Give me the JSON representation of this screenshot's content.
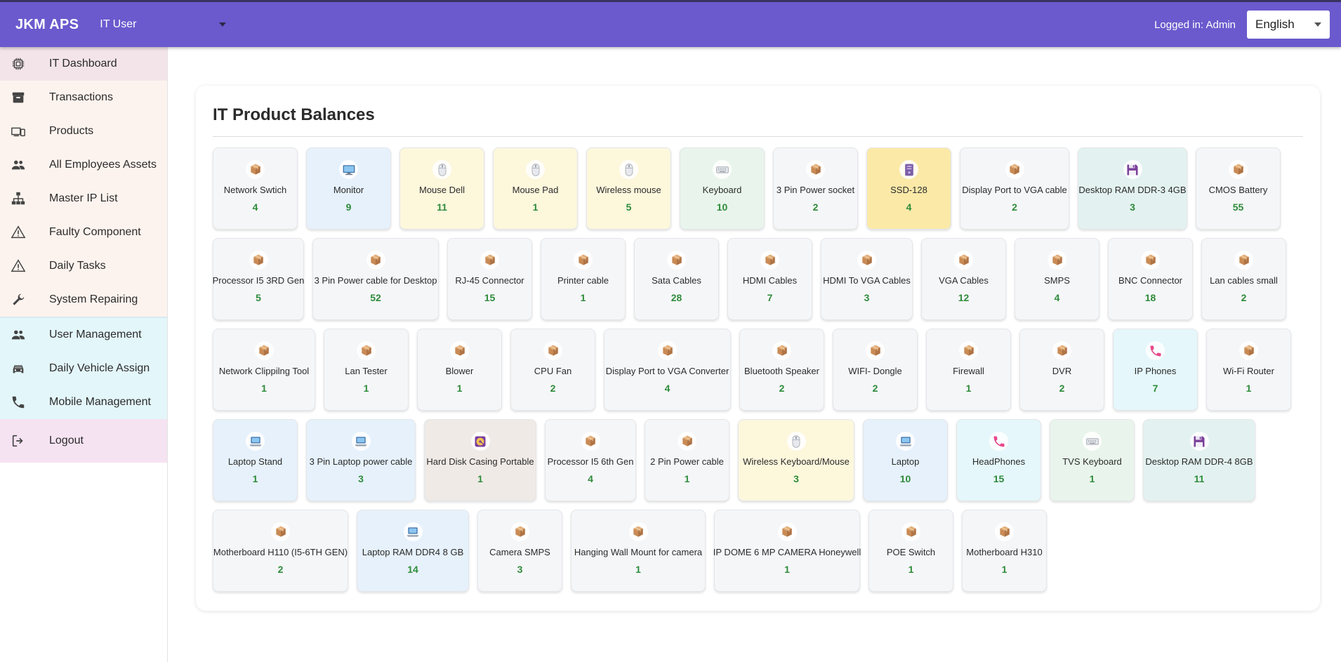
{
  "header": {
    "brand": "JKM APS",
    "role": "IT User",
    "logged_in": "Logged in: Admin",
    "language": "English"
  },
  "sidebar": {
    "group_main": [
      {
        "label": "IT Dashboard",
        "icon": "chip-icon"
      },
      {
        "label": "Transactions",
        "icon": "archive-icon"
      },
      {
        "label": "Products",
        "icon": "devices-icon"
      },
      {
        "label": "All Employees Assets",
        "icon": "people-icon"
      },
      {
        "label": "Master IP List",
        "icon": "network-icon"
      },
      {
        "label": "Faulty Component",
        "icon": "warning-icon"
      },
      {
        "label": "Daily Tasks",
        "icon": "warning-icon"
      },
      {
        "label": "System Repairing",
        "icon": "wrench-icon"
      }
    ],
    "group_admin": [
      {
        "label": "User Management",
        "icon": "people-icon"
      },
      {
        "label": "Daily Vehicle Assign",
        "icon": "car-icon"
      },
      {
        "label": "Mobile Management",
        "icon": "phone-icon"
      }
    ],
    "logout": "Logout"
  },
  "main": {
    "title": "IT Product Balances",
    "rows": [
      [
        {
          "name": "Network Swtich",
          "count": "4",
          "icon": "box",
          "color": "grey"
        },
        {
          "name": "Monitor",
          "count": "9",
          "icon": "monitor",
          "color": "blue"
        },
        {
          "name": "Mouse Dell",
          "count": "11",
          "icon": "mouse",
          "color": "yellow"
        },
        {
          "name": "Mouse Pad",
          "count": "1",
          "icon": "mouse",
          "color": "yellow"
        },
        {
          "name": "Wireless mouse",
          "count": "5",
          "icon": "mouse",
          "color": "yellow"
        },
        {
          "name": "Keyboard",
          "count": "10",
          "icon": "keyboard",
          "color": "green"
        },
        {
          "name": "3 Pin Power socket",
          "count": "2",
          "icon": "box",
          "color": "grey"
        },
        {
          "name": "SSD-128",
          "count": "4",
          "icon": "drive",
          "color": "gold"
        },
        {
          "name": "Display Port to VGA cable",
          "count": "2",
          "icon": "box",
          "color": "grey"
        },
        {
          "name": "Desktop RAM DDR-3 4GB",
          "count": "3",
          "icon": "floppy",
          "color": "teal"
        },
        {
          "name": "CMOS Battery",
          "count": "55",
          "icon": "box",
          "color": "grey"
        }
      ],
      [
        {
          "name": "Processor I5 3RD Gen",
          "count": "5",
          "icon": "box",
          "color": "grey"
        },
        {
          "name": "3 Pin Power cable for Desktop",
          "count": "52",
          "icon": "box",
          "color": "grey"
        },
        {
          "name": "RJ-45 Connector",
          "count": "15",
          "icon": "box",
          "color": "grey"
        },
        {
          "name": "Printer cable",
          "count": "1",
          "icon": "box",
          "color": "grey"
        },
        {
          "name": "Sata Cables",
          "count": "28",
          "icon": "box",
          "color": "grey"
        },
        {
          "name": "HDMI Cables",
          "count": "7",
          "icon": "box",
          "color": "grey"
        },
        {
          "name": "HDMI To VGA Cables",
          "count": "3",
          "icon": "box",
          "color": "grey"
        },
        {
          "name": "VGA Cables",
          "count": "12",
          "icon": "box",
          "color": "grey"
        },
        {
          "name": "SMPS",
          "count": "4",
          "icon": "box",
          "color": "grey"
        },
        {
          "name": "BNC Connector",
          "count": "18",
          "icon": "box",
          "color": "grey"
        },
        {
          "name": "Lan cables small",
          "count": "2",
          "icon": "box",
          "color": "grey"
        }
      ],
      [
        {
          "name": "Network Clippilng Tool",
          "count": "1",
          "icon": "box",
          "color": "grey"
        },
        {
          "name": "Lan Tester",
          "count": "1",
          "icon": "box",
          "color": "grey"
        },
        {
          "name": "Blower",
          "count": "1",
          "icon": "box",
          "color": "grey"
        },
        {
          "name": "CPU Fan",
          "count": "2",
          "icon": "box",
          "color": "grey"
        },
        {
          "name": "Display Port to VGA Converter",
          "count": "4",
          "icon": "box",
          "color": "grey"
        },
        {
          "name": "Bluetooth Speaker",
          "count": "2",
          "icon": "box",
          "color": "grey"
        },
        {
          "name": "WIFI- Dongle",
          "count": "2",
          "icon": "box",
          "color": "grey"
        },
        {
          "name": "Firewall",
          "count": "1",
          "icon": "box",
          "color": "grey"
        },
        {
          "name": "DVR",
          "count": "2",
          "icon": "box",
          "color": "grey"
        },
        {
          "name": "IP Phones",
          "count": "7",
          "icon": "phone",
          "color": "cyan"
        },
        {
          "name": "Wi-Fi Router",
          "count": "1",
          "icon": "box",
          "color": "grey"
        }
      ],
      [
        {
          "name": "Laptop Stand",
          "count": "1",
          "icon": "laptop",
          "color": "blue"
        },
        {
          "name": "3 Pin Laptop power cable",
          "count": "3",
          "icon": "laptop",
          "color": "blue"
        },
        {
          "name": "Hard Disk Casing Portable",
          "count": "1",
          "icon": "disk",
          "color": "beige"
        },
        {
          "name": "Processor I5 6th Gen",
          "count": "4",
          "icon": "box",
          "color": "grey"
        },
        {
          "name": "2 Pin Power cable",
          "count": "1",
          "icon": "box",
          "color": "grey"
        },
        {
          "name": "Wireless Keyboard/Mouse",
          "count": "3",
          "icon": "mouse",
          "color": "yellow"
        },
        {
          "name": "Laptop",
          "count": "10",
          "icon": "laptop",
          "color": "blue"
        },
        {
          "name": "HeadPhones",
          "count": "15",
          "icon": "phone",
          "color": "cyan"
        },
        {
          "name": "TVS Keyboard",
          "count": "1",
          "icon": "keyboard",
          "color": "green"
        },
        {
          "name": "Desktop RAM DDR-4 8GB",
          "count": "11",
          "icon": "floppy",
          "color": "teal"
        }
      ],
      [
        {
          "name": "Motherboard H110 (I5-6TH GEN)",
          "count": "2",
          "icon": "box",
          "color": "grey"
        },
        {
          "name": "Laptop RAM DDR4 8 GB",
          "count": "14",
          "icon": "laptop",
          "color": "blue"
        },
        {
          "name": "Camera SMPS",
          "count": "3",
          "icon": "box",
          "color": "grey"
        },
        {
          "name": "Hanging Wall Mount for camera",
          "count": "1",
          "icon": "box",
          "color": "grey"
        },
        {
          "name": "IP DOME 6 MP CAMERA Honeywell",
          "count": "1",
          "icon": "box",
          "color": "grey"
        },
        {
          "name": "POE Switch",
          "count": "1",
          "icon": "box",
          "color": "grey"
        },
        {
          "name": "Motherboard H310",
          "count": "1",
          "icon": "box",
          "color": "grey"
        }
      ]
    ]
  },
  "colors": {
    "header_bg": "#6a5acd",
    "count_text": "#2e8b3a",
    "group_main_bg": "#fdf3ee",
    "group_admin_bg": "#e3f6fa",
    "logout_bg": "#f6e3f2"
  }
}
